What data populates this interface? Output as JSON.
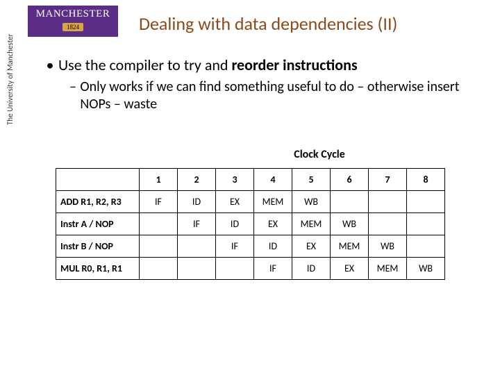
{
  "logo": {
    "name": "MANCHESTER",
    "year": "1824"
  },
  "sidebar": "The University of Manchester",
  "title": "Dealing with data dependencies (II)",
  "bullet": {
    "prefix": "Use the compiler to try and ",
    "bold": "reorder instructions"
  },
  "subbullet": "Only works if we can find something useful to do – otherwise insert NOPs – waste",
  "clock_label": "Clock Cycle",
  "chart_data": {
    "type": "table",
    "columns": [
      "1",
      "2",
      "3",
      "4",
      "5",
      "6",
      "7",
      "8"
    ],
    "rows": [
      {
        "label": "ADD R1, R2, R3",
        "cells": [
          "IF",
          "ID",
          "EX",
          "MEM",
          "WB",
          "",
          "",
          ""
        ]
      },
      {
        "label": "Instr A / NOP",
        "cells": [
          "",
          "IF",
          "ID",
          "EX",
          "MEM",
          "WB",
          "",
          ""
        ]
      },
      {
        "label": "Instr B / NOP",
        "cells": [
          "",
          "",
          "IF",
          "ID",
          "EX",
          "MEM",
          "WB",
          ""
        ]
      },
      {
        "label": "MUL R0, R1, R1",
        "cells": [
          "",
          "",
          "",
          "IF",
          "ID",
          "EX",
          "MEM",
          "WB"
        ]
      }
    ]
  }
}
